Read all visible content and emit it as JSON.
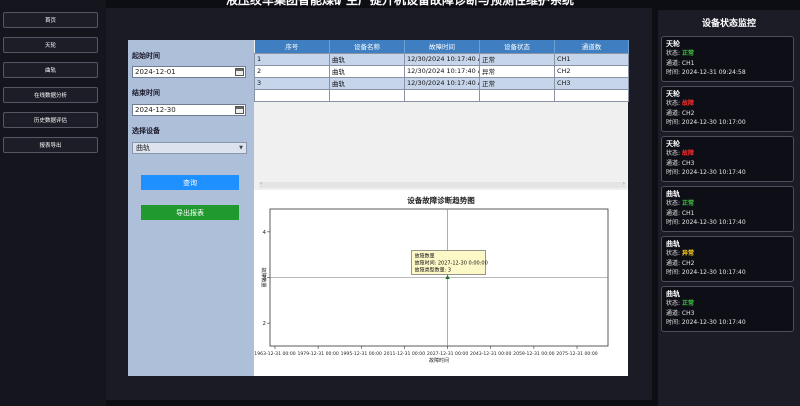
{
  "app": {
    "title": "液压绞车集团智能煤矿生产提升机设备故障诊断与预测性维护系统"
  },
  "sidebar": {
    "items": [
      {
        "label": "首页"
      },
      {
        "label": "天轮"
      },
      {
        "label": "曲轨"
      },
      {
        "label": "在线数据分析"
      },
      {
        "label": "历史数据评估"
      },
      {
        "label": "报表导出"
      }
    ]
  },
  "filters": {
    "start_label": "起始时间",
    "start_value": "2024-12-01",
    "end_label": "结束时间",
    "end_value": "2024-12-30",
    "device_label": "选择设备",
    "device_value": "曲轨",
    "query_label": "查询",
    "export_label": "导出报表"
  },
  "table": {
    "headers": [
      "序号",
      "设备名称",
      "故障时间",
      "设备状态",
      "通道数"
    ],
    "rows": [
      [
        "1",
        "曲轨",
        "12/30/2024 10:17:40 A",
        "正常",
        "CH1"
      ],
      [
        "2",
        "曲轨",
        "12/30/2024 10:17:40 A",
        "异常",
        "CH2"
      ],
      [
        "3",
        "曲轨",
        "12/30/2024 10:17:40 A",
        "正常",
        "CH3"
      ],
      [
        "",
        "",
        "",
        "",
        ""
      ]
    ]
  },
  "chart": {
    "title": "设备故障诊断趋势图",
    "tooltip": {
      "line1": "故障数量",
      "line2": "故障时间: 2027-12-30 0:00:00",
      "line3": "故障类型数量: 3"
    }
  },
  "chart_data": {
    "type": "scatter",
    "title": "设备故障诊断趋势图",
    "xlabel": "故障时间",
    "ylabel": "故障数量",
    "x_ticks": [
      "1963-12-31 00:00",
      "1979-12-31 00:00",
      "1995-12-31 00:00",
      "2011-12-31 00:00",
      "2027-12-31 00:00",
      "2043-12-31 00:00",
      "2059-12-31 00:00",
      "2075-12-31 00:00"
    ],
    "y_ticks": [
      2,
      3,
      4
    ],
    "ylim": [
      1.5,
      4.5
    ],
    "series": [
      {
        "x": [
          "2027-12-30 00:00"
        ],
        "y": [
          3
        ]
      }
    ]
  },
  "monitor": {
    "title": "设备状态监控",
    "status_prefix": "状态: ",
    "channel_prefix": "通道: ",
    "time_prefix": "时间: ",
    "cards": [
      {
        "name": "天轮",
        "status": "正常",
        "status_color": "#3ec93e",
        "channel": "CH1",
        "time": "2024-12-31 09:24:58"
      },
      {
        "name": "天轮",
        "status": "故障",
        "status_color": "#ff2a2a",
        "channel": "CH2",
        "time": "2024-12-30 10:17:00"
      },
      {
        "name": "天轮",
        "status": "故障",
        "status_color": "#ff2a2a",
        "channel": "CH3",
        "time": "2024-12-30 10:17:40"
      },
      {
        "name": "曲轨",
        "status": "正常",
        "status_color": "#3ec93e",
        "channel": "CH1",
        "time": "2024-12-30 10:17:40"
      },
      {
        "name": "曲轨",
        "status": "异常",
        "status_color": "#ffd21f",
        "channel": "CH2",
        "time": "2024-12-30 10:17:40"
      },
      {
        "name": "曲轨",
        "status": "正常",
        "status_color": "#3ec93e",
        "channel": "CH3",
        "time": "2024-12-30 10:17:40"
      }
    ]
  }
}
